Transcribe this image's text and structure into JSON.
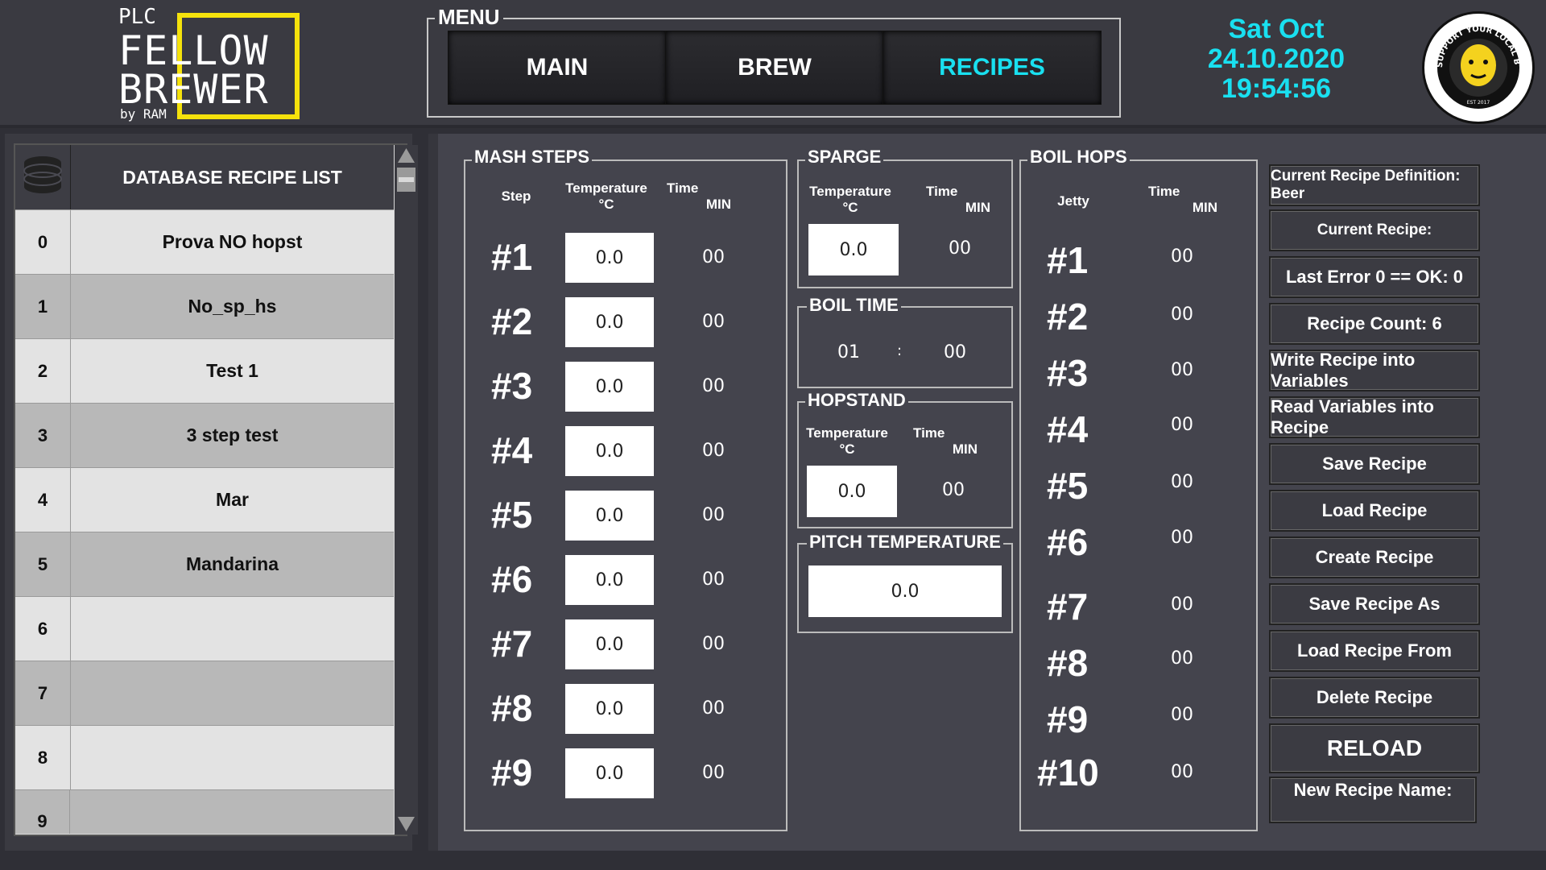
{
  "logo": {
    "top": "PLC",
    "line1": "FELLOW",
    "line2": "BREWER",
    "by": "by RAM"
  },
  "menu": {
    "title": "MENU",
    "tabs": [
      {
        "label": "MAIN",
        "color": "#ffffff"
      },
      {
        "label": "BREW",
        "color": "#ffffff"
      },
      {
        "label": "RECIPES",
        "color": "#19e0f0"
      }
    ]
  },
  "datetime": {
    "day": "Sat Oct",
    "date": "24.10.2020",
    "time": "19:54:56"
  },
  "badge": {
    "text": "SUPPORT YOUR LOCAL BREWER",
    "est": "EST 2017"
  },
  "recipe_list": {
    "title": "DATABASE RECIPE LIST",
    "rows": [
      {
        "index": "0",
        "name": "Prova NO hopst"
      },
      {
        "index": "1",
        "name": "No_sp_hs"
      },
      {
        "index": "2",
        "name": "Test 1"
      },
      {
        "index": "3",
        "name": "3 step test"
      },
      {
        "index": "4",
        "name": "Mar"
      },
      {
        "index": "5",
        "name": "Mandarina"
      },
      {
        "index": "6",
        "name": ""
      },
      {
        "index": "7",
        "name": ""
      },
      {
        "index": "8",
        "name": ""
      },
      {
        "index": "9",
        "name": ""
      }
    ]
  },
  "mash": {
    "title": "MASH STEPS",
    "col_step": "Step",
    "col_temp": "Temperature",
    "col_temp_unit": "°C",
    "col_time": "Time",
    "col_time_unit": "MIN",
    "steps": [
      {
        "label": "#1",
        "temp": "0.0",
        "time": "00"
      },
      {
        "label": "#2",
        "temp": "0.0",
        "time": "00"
      },
      {
        "label": "#3",
        "temp": "0.0",
        "time": "00"
      },
      {
        "label": "#4",
        "temp": "0.0",
        "time": "00"
      },
      {
        "label": "#5",
        "temp": "0.0",
        "time": "00"
      },
      {
        "label": "#6",
        "temp": "0.0",
        "time": "00"
      },
      {
        "label": "#7",
        "temp": "0.0",
        "time": "00"
      },
      {
        "label": "#8",
        "temp": "0.0",
        "time": "00"
      },
      {
        "label": "#9",
        "temp": "0.0",
        "time": "00"
      }
    ]
  },
  "sparge": {
    "title": "SPARGE",
    "col_temp": "Temperature",
    "col_temp_unit": "°C",
    "col_time": "Time",
    "col_time_unit": "MIN",
    "temp": "0.0",
    "time": "00"
  },
  "boil_time": {
    "title": "BOIL TIME",
    "hours": "01",
    "sep": ":",
    "minutes": "00"
  },
  "hopstand": {
    "title": "HOPSTAND",
    "col_temp": "Temperature",
    "col_temp_unit": "°C",
    "col_time": "Time",
    "col_time_unit": "MIN",
    "temp": "0.0",
    "time": "00"
  },
  "pitch": {
    "title": "PITCH TEMPERATURE",
    "temp": "0.0"
  },
  "boil_hops": {
    "title": "BOIL HOPS",
    "col_jetty": "Jetty",
    "col_time": "Time",
    "col_time_unit": "MIN",
    "hops": [
      {
        "label": "#1",
        "time": "00"
      },
      {
        "label": "#2",
        "time": "00"
      },
      {
        "label": "#3",
        "time": "00"
      },
      {
        "label": "#4",
        "time": "00"
      },
      {
        "label": "#5",
        "time": "00"
      },
      {
        "label": "#6",
        "time": "00"
      },
      {
        "label": "#7",
        "time": "00"
      },
      {
        "label": "#8",
        "time": "00"
      },
      {
        "label": "#9",
        "time": "00"
      },
      {
        "label": "#10",
        "time": "00"
      }
    ]
  },
  "actions": {
    "current_def": "Current Recipe Definition: Beer",
    "current_recipe": "Current Recipe:",
    "last_error": "Last Error 0 == OK: 0",
    "recipe_count": "Recipe Count: 6",
    "write": "Write Recipe into Variables",
    "read": "Read Variables into Recipe",
    "save": "Save Recipe",
    "load": "Load Recipe",
    "create": "Create Recipe",
    "save_as": "Save Recipe As",
    "load_from": "Load Recipe From",
    "delete": "Delete Recipe",
    "reload": "RELOAD",
    "new_name": "New Recipe Name:"
  }
}
